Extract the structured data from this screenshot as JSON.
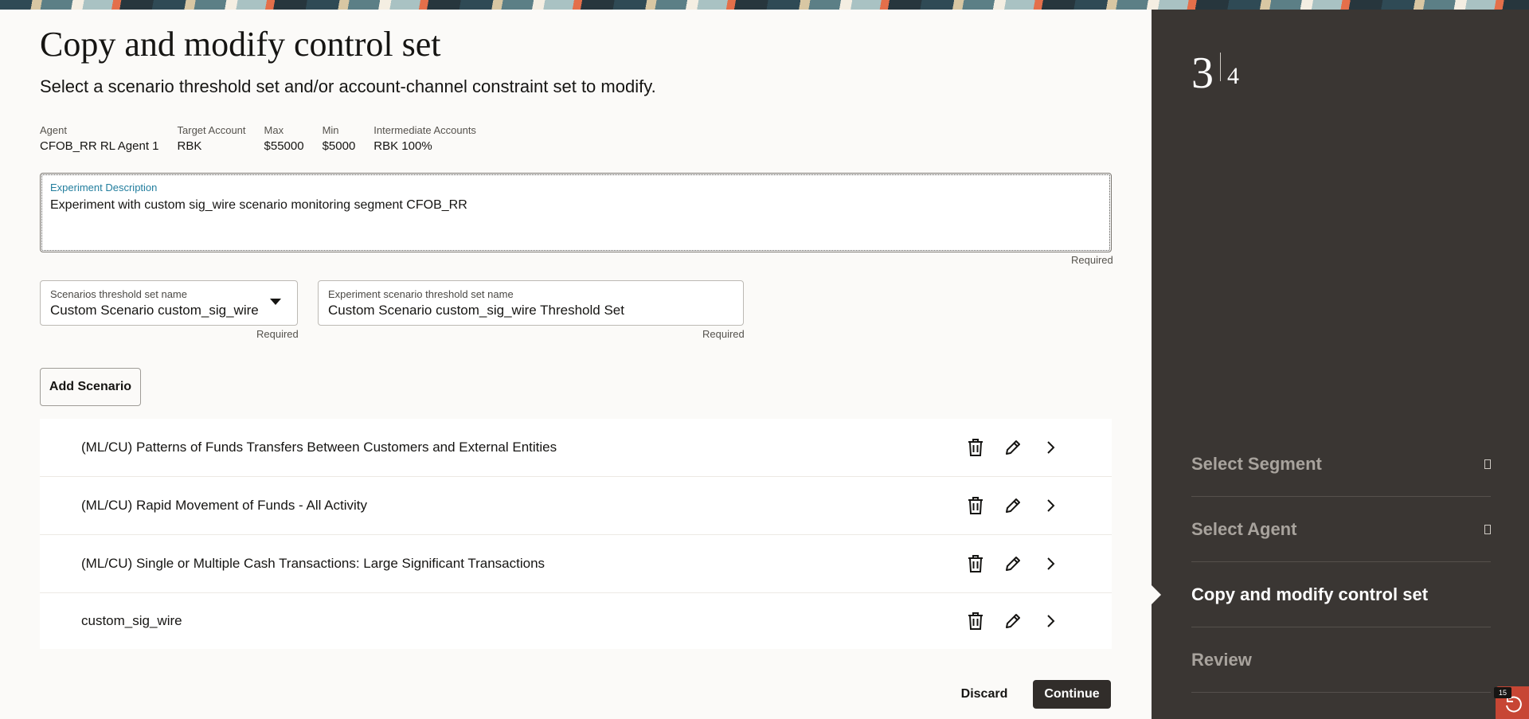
{
  "page": {
    "title": "Copy and modify control set",
    "subtitle": "Select a scenario threshold set and/or account-channel constraint set to modify."
  },
  "agent_info": [
    {
      "label": "Agent",
      "value": "CFOB_RR RL Agent 1"
    },
    {
      "label": "Target Account",
      "value": "RBK"
    },
    {
      "label": "Max",
      "value": "$55000"
    },
    {
      "label": "Min",
      "value": "$5000"
    },
    {
      "label": "Intermediate Accounts",
      "value": "RBK 100%"
    }
  ],
  "experiment_description": {
    "label": "Experiment Description",
    "value": "Experiment with custom sig_wire scenario monitoring segment CFOB_RR",
    "required": "Required"
  },
  "threshold_select": {
    "label": "Scenarios threshold set name",
    "value": "Custom Scenario custom_sig_wire",
    "required": "Required"
  },
  "threshold_name_input": {
    "label": "Experiment scenario threshold set name",
    "value": "Custom Scenario custom_sig_wire Threshold Set",
    "required": "Required"
  },
  "add_scenario_label": "Add Scenario",
  "scenarios": [
    {
      "label": "(ML/CU) Patterns of Funds Transfers Between Customers and External Entities"
    },
    {
      "label": "(ML/CU) Rapid Movement of Funds - All Activity"
    },
    {
      "label": "(ML/CU) Single or Multiple Cash Transactions: Large Significant Transactions"
    },
    {
      "label": "custom_sig_wire"
    }
  ],
  "actions": {
    "discard": "Discard",
    "continue": "Continue"
  },
  "sidebar": {
    "step_current": "3",
    "step_total": "4",
    "steps": [
      {
        "label": "Select Segment",
        "state": "completed"
      },
      {
        "label": "Select Agent",
        "state": "completed"
      },
      {
        "label": "Copy and modify control set",
        "state": "active"
      },
      {
        "label": "Review",
        "state": "pending"
      }
    ]
  },
  "help": {
    "count": "15"
  },
  "colors": {
    "sidebar_bg": "#3a3633",
    "primary_button": "#312d2a",
    "label_accent": "#227e9e",
    "help_badge": "#c74634"
  }
}
